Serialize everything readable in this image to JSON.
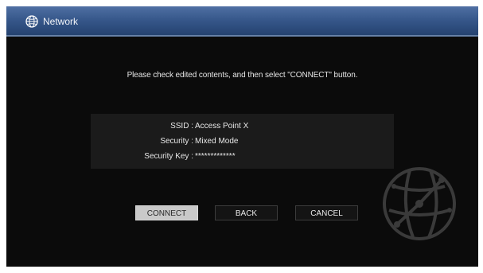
{
  "window": {
    "title": "Network",
    "title_icon": "network-icon"
  },
  "message": "Please check edited contents, and then select \"CONNECT\" button.",
  "info": [
    {
      "label": "SSID :",
      "value": "Access Point X"
    },
    {
      "label": "Security :",
      "value": "Mixed Mode"
    },
    {
      "label": "Security Key :",
      "value": "*************"
    }
  ],
  "buttons": {
    "connect": "CONNECT",
    "back": "BACK",
    "cancel": "CANCEL"
  },
  "selected_button": "CONNECT",
  "decoration": {
    "watermark_icon": "globe-network-icon"
  },
  "colors": {
    "titlebar": "#36578a",
    "background": "#0b0b0b",
    "selected_button": "#c9c9c9"
  }
}
